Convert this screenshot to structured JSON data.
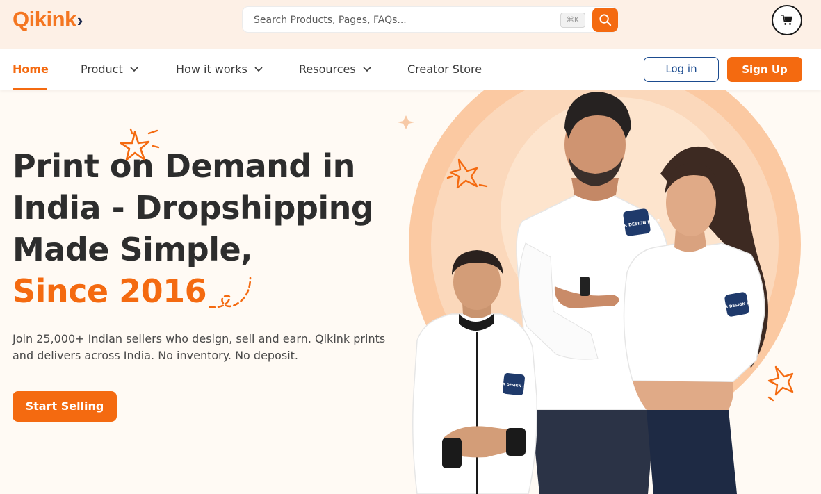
{
  "brand": {
    "logo_text": "Qikink",
    "logo_mark": "›",
    "accent": "#f46a10",
    "navy": "#1d2a4e"
  },
  "search": {
    "placeholder": "Search Products, Pages, FAQs...",
    "shortcut": "⌘K"
  },
  "nav": {
    "items": [
      {
        "label": "Home",
        "active": true
      },
      {
        "label": "Product",
        "has_dropdown": true
      },
      {
        "label": "How it works",
        "has_dropdown": true
      },
      {
        "label": "Resources",
        "has_dropdown": true
      },
      {
        "label": "Creator Store"
      }
    ],
    "login_label": "Log in",
    "signup_label": "Sign Up"
  },
  "hero": {
    "heading_lines": [
      "Print on Demand in",
      "India - Dropshipping",
      "Made Simple,"
    ],
    "highlight": "Since 2016",
    "subtext": "Join 25,000+ Indian sellers who design, sell and earn. Qikink prints and delivers across India. No inventory. No deposit.",
    "cta_label": "Start Selling",
    "badge_text": "YOUR DESIGN HERE"
  },
  "icons": [
    "search-icon",
    "cart-icon",
    "chevron-down-icon",
    "sparkle-icon",
    "squiggle-icon"
  ]
}
